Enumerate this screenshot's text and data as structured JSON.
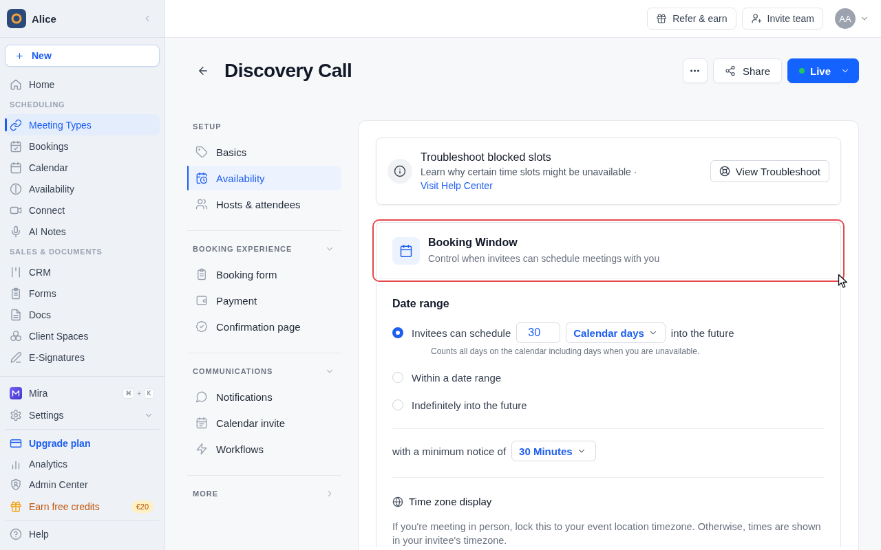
{
  "sidebar": {
    "workspace": "Alice",
    "new_button": "New",
    "groups": [
      {
        "items": [
          {
            "label": "Home",
            "selected": false
          }
        ]
      },
      {
        "heading": "SCHEDULING",
        "items": [
          {
            "label": "Meeting Types",
            "selected": true
          },
          {
            "label": "Bookings",
            "selected": false
          },
          {
            "label": "Calendar",
            "selected": false
          },
          {
            "label": "Availability",
            "selected": false
          },
          {
            "label": "Connect",
            "selected": false
          },
          {
            "label": "AI Notes",
            "selected": false
          }
        ]
      },
      {
        "heading": "SALES & DOCUMENTS",
        "items": [
          {
            "label": "CRM",
            "selected": false
          },
          {
            "label": "Forms",
            "selected": false
          },
          {
            "label": "Docs",
            "selected": false
          },
          {
            "label": "Client Spaces",
            "selected": false
          },
          {
            "label": "E-Signatures",
            "selected": false
          }
        ]
      }
    ],
    "assistant": {
      "label": "Mira",
      "shortcut": {
        "keys": [
          "⌘",
          "K"
        ],
        "separator": "+"
      }
    },
    "settings": {
      "label": "Settings",
      "expanded": false
    },
    "links": [
      {
        "kind": "upgrade",
        "label": "Upgrade plan"
      },
      {
        "kind": "plain",
        "label": "Analytics"
      },
      {
        "kind": "plain",
        "label": "Admin Center"
      },
      {
        "kind": "reward",
        "label": "Earn free credits",
        "badge": "€20"
      }
    ],
    "help": "Help"
  },
  "top_bar": {
    "buttons": [
      {
        "label": "Refer & earn"
      },
      {
        "label": "Invite team"
      }
    ],
    "avatar": "AA"
  },
  "page": {
    "title": "Discovery Call",
    "share": "Share",
    "status": {
      "label": "Live",
      "active": true
    }
  },
  "settings_nav": {
    "sections": [
      {
        "heading": "SETUP",
        "kind": "static",
        "items": [
          {
            "label": "Basics",
            "selected": false
          },
          {
            "label": "Availability",
            "selected": true
          },
          {
            "label": "Hosts & attendees",
            "selected": false
          }
        ]
      },
      {
        "heading": "BOOKING EXPERIENCE",
        "kind": "collapsible",
        "expanded": true,
        "items": [
          {
            "label": "Booking form",
            "selected": false
          },
          {
            "label": "Payment",
            "selected": false
          },
          {
            "label": "Confirmation page",
            "selected": false
          }
        ]
      },
      {
        "heading": "COMMUNICATIONS",
        "kind": "collapsible",
        "expanded": true,
        "items": [
          {
            "label": "Notifications",
            "selected": false
          },
          {
            "label": "Calendar invite",
            "selected": false
          },
          {
            "label": "Workflows",
            "selected": false
          }
        ]
      },
      {
        "heading": "MORE",
        "kind": "collapsible",
        "expanded": false
      }
    ]
  },
  "troubleshoot": {
    "title": "Troubleshoot blocked slots",
    "text": "Learn why certain time slots might be unavailable ·",
    "link": "Visit Help Center",
    "button": "View Troubleshoot"
  },
  "booking_window": {
    "title": "Booking Window",
    "subtitle": "Control when invitees can schedule meetings with you",
    "highlighted": true,
    "date_range": {
      "heading": "Date range",
      "options": [
        {
          "kind": "rolling",
          "selected": true,
          "label": "Invitees can schedule",
          "amount": "30",
          "unit": "Calendar days",
          "suffix": "into the future",
          "hint": "Counts all days on the calendar including days when you are unavailable."
        },
        {
          "kind": "plain",
          "selected": false,
          "label": "Within a date range"
        },
        {
          "kind": "plain",
          "selected": false,
          "label": "Indefinitely into the future"
        }
      ]
    },
    "minimum_notice": {
      "label": "with a minimum notice of",
      "value": "30 Minutes"
    },
    "time_zone": {
      "heading": "Time zone display",
      "text": "If you're meeting in person, lock this to your event location timezone. Otherwise, times are shown in your invitee's timezone."
    }
  }
}
